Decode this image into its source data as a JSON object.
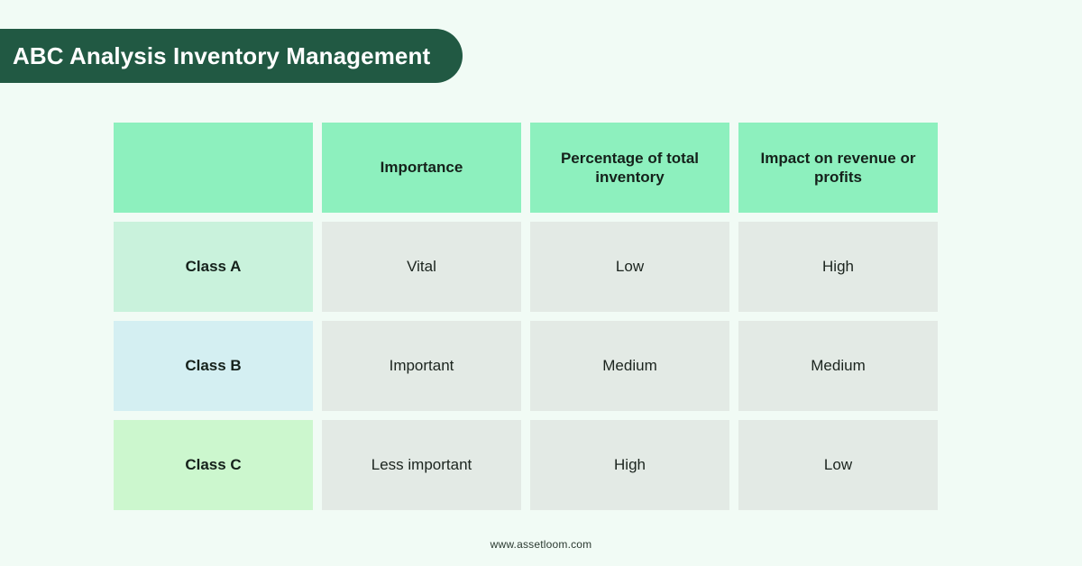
{
  "banner": {
    "title": "ABC Analysis Inventory Management",
    "background_color": "#215943",
    "text_color": "#ffffff"
  },
  "colors": {
    "page_background": "#f1fbf5",
    "header_cell": "#8df0be",
    "data_cell": "#e3eae5",
    "class_a_label": "#c9f2dc",
    "class_b_label": "#d4eff2",
    "class_c_label": "#ccf7ce",
    "text_dark": "#15211b"
  },
  "table": {
    "headers": {
      "corner": "",
      "col1": "Importance",
      "col2": "Percentage of total inventory",
      "col3": "Impact on revenue or profits"
    },
    "rows": [
      {
        "label": "Class A",
        "label_color": "#c9f2dc",
        "importance": "Vital",
        "percentage_of_total_inventory": "Low",
        "impact_on_revenue_or_profits": "High"
      },
      {
        "label": "Class B",
        "label_color": "#d4eff2",
        "importance": "Important",
        "percentage_of_total_inventory": "Medium",
        "impact_on_revenue_or_profits": "Medium"
      },
      {
        "label": "Class C",
        "label_color": "#ccf7ce",
        "importance": "Less important",
        "percentage_of_total_inventory": "High",
        "impact_on_revenue_or_profits": "Low"
      }
    ]
  },
  "footer": {
    "url": "www.assetloom.com"
  }
}
